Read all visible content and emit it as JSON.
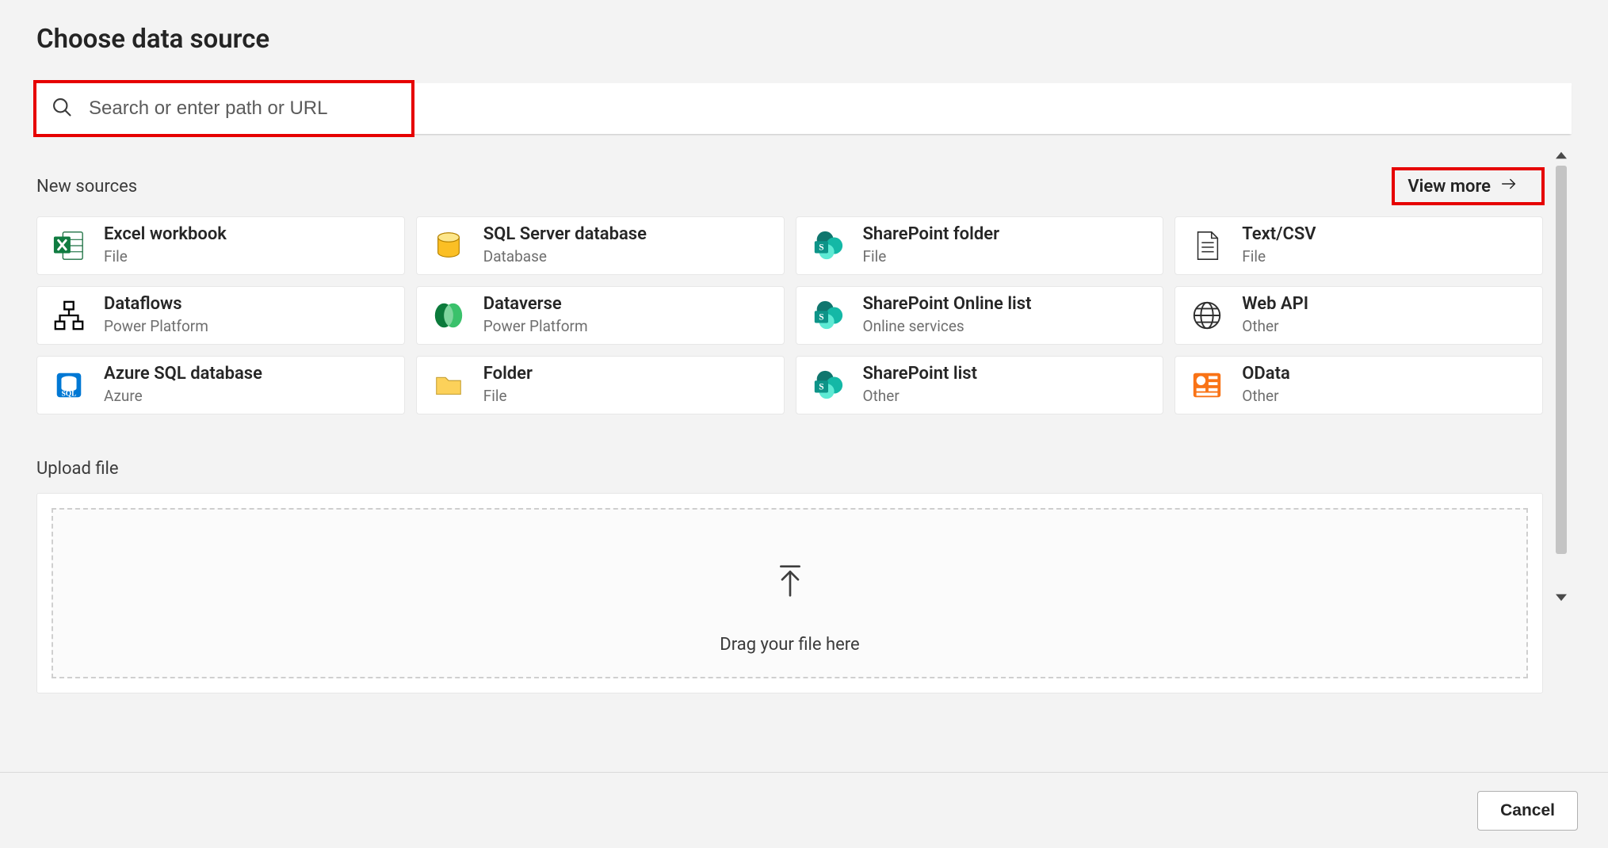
{
  "title": "Choose data source",
  "search": {
    "placeholder": "Search or enter path or URL"
  },
  "sections": {
    "new_sources": {
      "label": "New sources",
      "view_more": "View more"
    },
    "upload": {
      "label": "Upload file",
      "drag_text": "Drag your file here"
    }
  },
  "sources": [
    {
      "name": "Excel workbook",
      "category": "File",
      "icon": "excel"
    },
    {
      "name": "SQL Server database",
      "category": "Database",
      "icon": "sqlserver"
    },
    {
      "name": "SharePoint folder",
      "category": "File",
      "icon": "sharepoint"
    },
    {
      "name": "Text/CSV",
      "category": "File",
      "icon": "textcsv"
    },
    {
      "name": "Dataflows",
      "category": "Power Platform",
      "icon": "dataflows"
    },
    {
      "name": "Dataverse",
      "category": "Power Platform",
      "icon": "dataverse"
    },
    {
      "name": "SharePoint Online list",
      "category": "Online services",
      "icon": "sharepoint"
    },
    {
      "name": "Web API",
      "category": "Other",
      "icon": "webapi"
    },
    {
      "name": "Azure SQL database",
      "category": "Azure",
      "icon": "azuresql"
    },
    {
      "name": "Folder",
      "category": "File",
      "icon": "folder"
    },
    {
      "name": "SharePoint list",
      "category": "Other",
      "icon": "sharepoint"
    },
    {
      "name": "OData",
      "category": "Other",
      "icon": "odata"
    }
  ],
  "footer": {
    "cancel": "Cancel"
  },
  "highlights": {
    "search": true,
    "view_more": true
  }
}
